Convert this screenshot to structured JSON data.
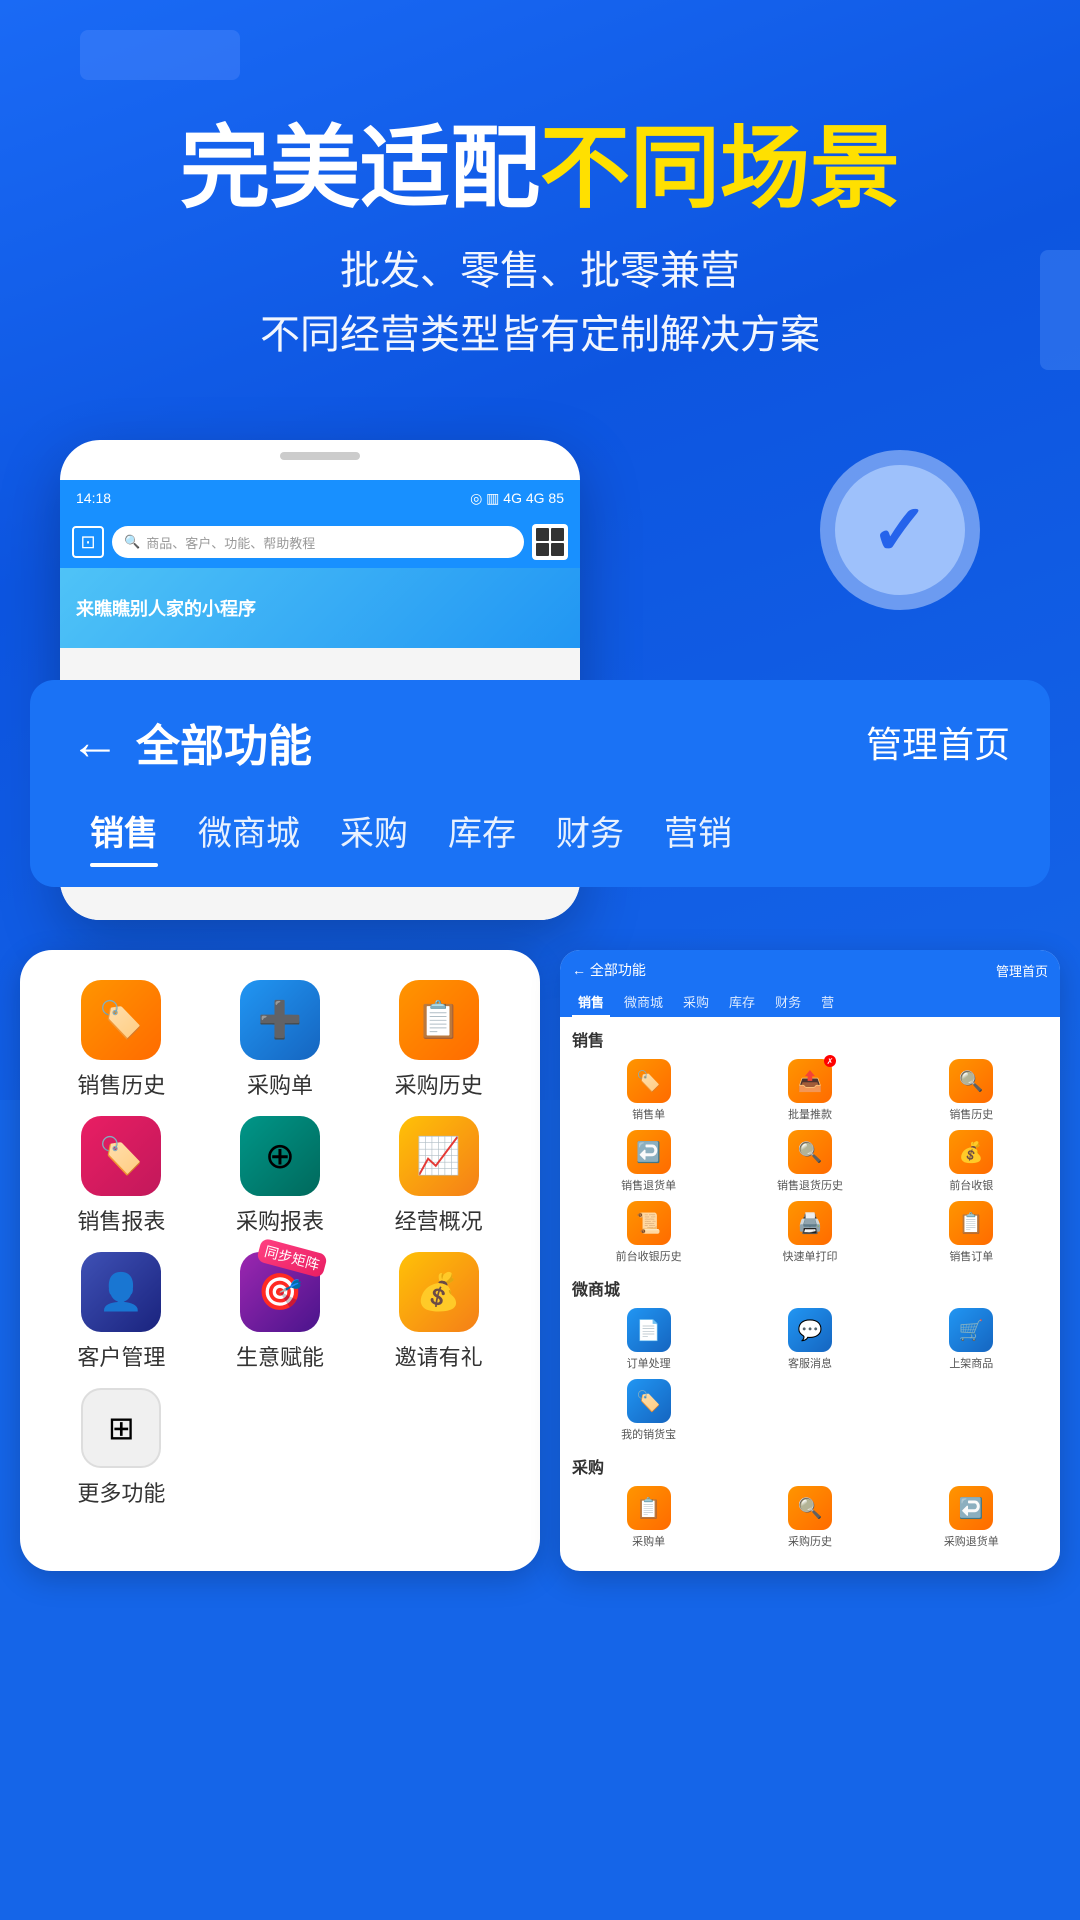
{
  "app": {
    "title": "完美适配不同场景",
    "title_white": "完美适配",
    "title_yellow": "不同场景",
    "subtitle_line1": "批发、零售、批零兼营",
    "subtitle_line2": "不同经营类型皆有定制解决方案"
  },
  "phone_screen": {
    "time": "14:18",
    "search_placeholder": "商品、客户、功能、帮助教程",
    "collect_label": "收款码",
    "scan_label": "扫一扫",
    "banner_text": "来瞧瞧别人家的小程序"
  },
  "panel": {
    "back_label": "全部功能",
    "manage_label": "管理首页",
    "tabs": [
      "销售",
      "微商城",
      "采购",
      "库存",
      "财务",
      "营销"
    ]
  },
  "features_left": [
    {
      "label": "销售历史",
      "icon": "🏷️",
      "color": "orange",
      "badge": null
    },
    {
      "label": "采购单",
      "icon": "➕",
      "color": "blue",
      "badge": null
    },
    {
      "label": "采购历史",
      "icon": "📋",
      "color": "orange",
      "badge": null
    },
    {
      "label": "销售报表",
      "icon": "🏷️",
      "color": "pink",
      "badge": null
    },
    {
      "label": "采购报表",
      "icon": "⊕",
      "color": "teal",
      "badge": null
    },
    {
      "label": "经营概况",
      "icon": "📈",
      "color": "amber",
      "badge": null
    },
    {
      "label": "客户管理",
      "icon": "👤",
      "color": "indigo",
      "badge": null
    },
    {
      "label": "生意赋能",
      "icon": "🎯",
      "color": "purple",
      "badge": "同步矩阵"
    },
    {
      "label": "邀请有礼",
      "icon": "💰",
      "color": "amber",
      "badge": null
    },
    {
      "label": "更多功能",
      "icon": "⊞",
      "color": "gray",
      "badge": null
    }
  ],
  "right_panel": {
    "back_label": "← 全部功能",
    "manage_label": "管理首页",
    "tabs": [
      "销售",
      "微商城",
      "采购",
      "库存",
      "财务",
      "营"
    ],
    "sections": [
      {
        "title": "销售",
        "items": [
          {
            "label": "销售单",
            "icon": "🏷️",
            "color": "orange"
          },
          {
            "label": "批量推款",
            "icon": "📤",
            "color": "orange"
          },
          {
            "label": "销售历史",
            "icon": "🔍",
            "color": "orange"
          },
          {
            "label": "销售退货单",
            "icon": "↩️",
            "color": "orange"
          },
          {
            "label": "销售退货历史",
            "icon": "🔍",
            "color": "orange"
          },
          {
            "label": "前台收银",
            "icon": "💰",
            "color": "orange"
          },
          {
            "label": "前台收银历史",
            "icon": "📜",
            "color": "orange"
          },
          {
            "label": "快速单打印",
            "icon": "🖨️",
            "color": "orange"
          },
          {
            "label": "销售订单",
            "icon": "📋",
            "color": "orange"
          }
        ]
      },
      {
        "title": "微商城",
        "items": [
          {
            "label": "订单处理",
            "icon": "📄",
            "color": "blue"
          },
          {
            "label": "客服消息",
            "icon": "💬",
            "color": "blue"
          },
          {
            "label": "上架商品",
            "icon": "🛒",
            "color": "blue"
          },
          {
            "label": "我的销货宝",
            "icon": "🏷️",
            "color": "blue"
          }
        ]
      },
      {
        "title": "采购",
        "items": [
          {
            "label": "采购单",
            "icon": "📋",
            "color": "orange"
          },
          {
            "label": "采购历史",
            "icon": "🔍",
            "color": "orange"
          },
          {
            "label": "采购退货单",
            "icon": "↩️",
            "color": "orange"
          }
        ]
      }
    ]
  },
  "colors": {
    "brand_blue": "#1565e8",
    "panel_blue": "#1a72f5",
    "yellow": "#ffe000",
    "white": "#ffffff"
  }
}
